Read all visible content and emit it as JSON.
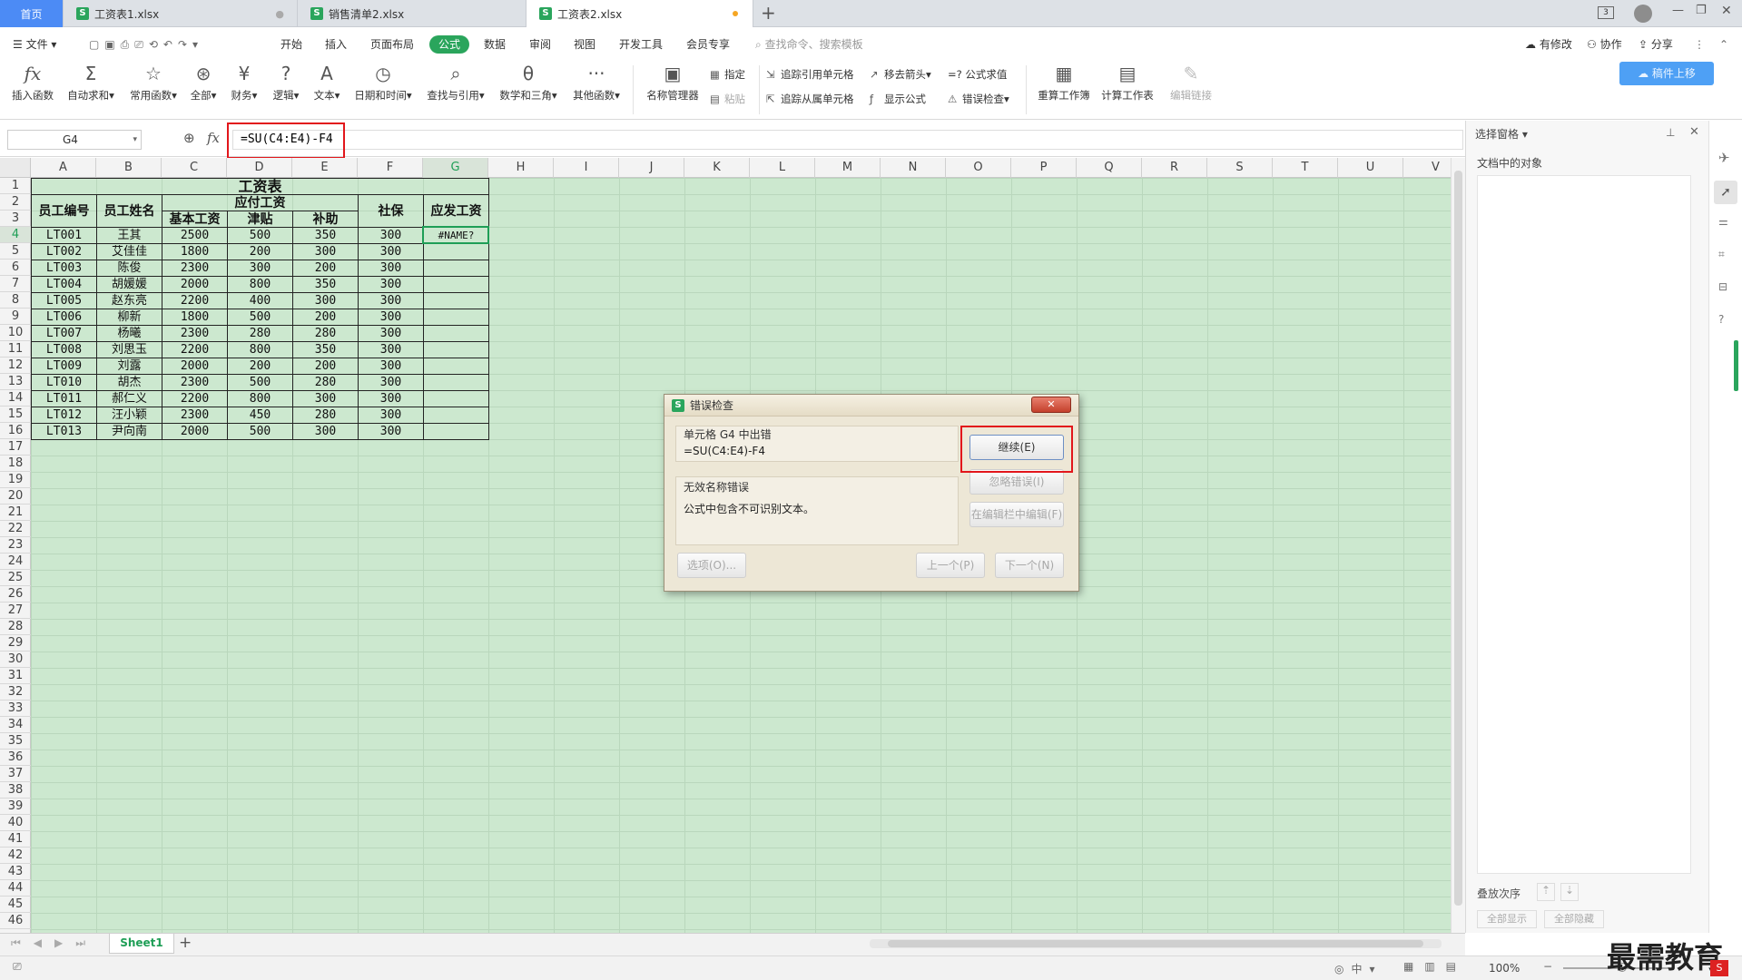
{
  "tabs": {
    "home": "首页",
    "items": [
      {
        "label": "工资表1.xlsx",
        "close": "●"
      },
      {
        "label": "销售清单2.xlsx",
        "close": ""
      },
      {
        "label": "工资表2.xlsx",
        "close": "●"
      }
    ],
    "add": "+",
    "badge": "3"
  },
  "menu": {
    "file": "文件",
    "items": [
      "开始",
      "插入",
      "页面布局",
      "公式",
      "数据",
      "审阅",
      "视图",
      "开发工具",
      "会员专享"
    ],
    "active": "公式",
    "search_placeholder": "查找命令、搜索模板",
    "right": [
      "有修改",
      "协作",
      "分享"
    ]
  },
  "ribbon": {
    "big": [
      {
        "label": "插入函数",
        "icon": "fx-icon",
        "glyph": "fx"
      },
      {
        "label": "自动求和▾",
        "icon": "sigma-icon",
        "glyph": "Σ"
      },
      {
        "label": "常用函数▾",
        "icon": "star-icon",
        "glyph": "☆"
      },
      {
        "label": "全部▾",
        "icon": "asterisk-icon",
        "glyph": "⊛"
      },
      {
        "label": "财务▾",
        "icon": "yen-icon",
        "glyph": "¥"
      },
      {
        "label": "逻辑▾",
        "icon": "question-icon",
        "glyph": "?"
      },
      {
        "label": "文本▾",
        "icon": "text-icon",
        "glyph": "A"
      },
      {
        "label": "日期和时间▾",
        "icon": "clock-icon",
        "glyph": "◷"
      },
      {
        "label": "查找与引用▾",
        "icon": "lookup-icon",
        "glyph": "⌕"
      },
      {
        "label": "数学和三角▾",
        "icon": "theta-icon",
        "glyph": "θ"
      },
      {
        "label": "其他函数▾",
        "icon": "more-icon",
        "glyph": "···"
      },
      {
        "label": "名称管理器",
        "icon": "name-manager-icon",
        "glyph": "▣"
      }
    ],
    "small": {
      "specify": "指定",
      "paste": "粘贴",
      "trace_precedents": "追踪引用单元格",
      "trace_dependents": "追踪从属单元格",
      "remove_arrows": "移去箭头▾",
      "show_formulas": "显示公式",
      "evaluate": "=? 公式求值",
      "error_check": "错误检查▾"
    },
    "right_big": [
      {
        "label": "重算工作簿",
        "icon": "recalc-book-icon",
        "glyph": "▦"
      },
      {
        "label": "计算工作表",
        "icon": "calc-sheet-icon",
        "glyph": "▤"
      },
      {
        "label": "编辑链接",
        "icon": "edit-link-icon",
        "glyph": "✎"
      }
    ],
    "cloud_btn": "稿件上移"
  },
  "formula_bar": {
    "cell_ref": "G4",
    "fx": "fx",
    "formula": "=SU(C4:E4)-F4"
  },
  "grid": {
    "columns": [
      "A",
      "B",
      "C",
      "D",
      "E",
      "F",
      "G",
      "H",
      "I",
      "J",
      "K",
      "L",
      "M",
      "N",
      "O",
      "P",
      "Q",
      "R",
      "S",
      "T",
      "U",
      "V"
    ],
    "rows": [
      "1",
      "2",
      "3",
      "4",
      "5",
      "6",
      "7",
      "8",
      "9",
      "10",
      "11",
      "12",
      "13",
      "14",
      "15",
      "16",
      "17",
      "18",
      "19",
      "20",
      "21",
      "22",
      "23",
      "24",
      "25",
      "26",
      "27",
      "28",
      "29",
      "30",
      "31",
      "32",
      "33",
      "34",
      "35",
      "36",
      "37",
      "38",
      "39",
      "40",
      "41",
      "42",
      "43",
      "44",
      "45",
      "46"
    ]
  },
  "sheet_table": {
    "title": "工资表",
    "h_id": "员工编号",
    "h_name": "员工姓名",
    "h_payable": "应付工资",
    "h_base": "基本工资",
    "h_allowance": "津贴",
    "h_subsidy": "补助",
    "h_social": "社保",
    "h_net": "应发工资",
    "rows": [
      [
        "LT001",
        "王其",
        "2500",
        "500",
        "350",
        "300",
        "#NAME?"
      ],
      [
        "LT002",
        "艾佳佳",
        "1800",
        "200",
        "300",
        "300",
        ""
      ],
      [
        "LT003",
        "陈俊",
        "2300",
        "300",
        "200",
        "300",
        ""
      ],
      [
        "LT004",
        "胡媛媛",
        "2000",
        "800",
        "350",
        "300",
        ""
      ],
      [
        "LT005",
        "赵东亮",
        "2200",
        "400",
        "300",
        "300",
        ""
      ],
      [
        "LT006",
        "柳新",
        "1800",
        "500",
        "200",
        "300",
        ""
      ],
      [
        "LT007",
        "杨曦",
        "2300",
        "280",
        "280",
        "300",
        ""
      ],
      [
        "LT008",
        "刘思玉",
        "2200",
        "800",
        "350",
        "300",
        ""
      ],
      [
        "LT009",
        "刘露",
        "2000",
        "200",
        "200",
        "300",
        ""
      ],
      [
        "LT010",
        "胡杰",
        "2300",
        "500",
        "280",
        "300",
        ""
      ],
      [
        "LT011",
        "郝仁义",
        "2200",
        "800",
        "300",
        "300",
        ""
      ],
      [
        "LT012",
        "汪小颖",
        "2300",
        "450",
        "280",
        "300",
        ""
      ],
      [
        "LT013",
        "尹向南",
        "2000",
        "500",
        "300",
        "300",
        ""
      ]
    ]
  },
  "dialog": {
    "title": "错误检查",
    "cell_error": "单元格 G4 中出错",
    "formula": "=SU(C4:E4)-F4",
    "error_type": "无效名称错误",
    "error_desc": "公式中包含不可识别文本。",
    "btn_continue": "继续(E)",
    "btn_ignore": "忽略错误(I)",
    "btn_edit": "在编辑栏中编辑(F)",
    "btn_options": "选项(O)...",
    "btn_prev": "上一个(P)",
    "btn_next": "下一个(N)",
    "close": "✕"
  },
  "pane": {
    "title": "选择窗格 ▾",
    "objects": "文档中的对象",
    "order": "叠放次序",
    "show_all": "全部显示",
    "hide_all": "全部隐藏"
  },
  "sheets": {
    "active": "Sheet1",
    "add": "+"
  },
  "status": {
    "zoom": "100%",
    "watermark": "最需教育"
  }
}
